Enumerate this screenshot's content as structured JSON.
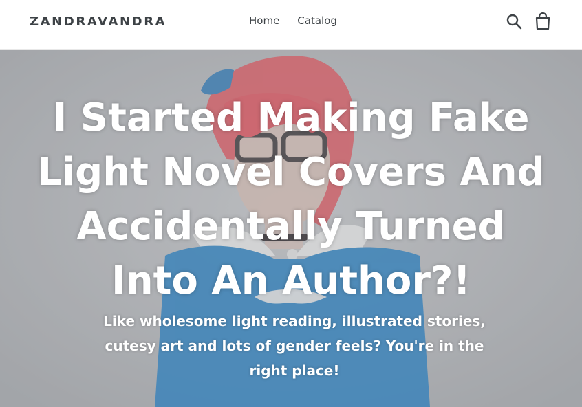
{
  "header": {
    "logo": "ZANDRAVANDRA",
    "nav": [
      {
        "label": "Home",
        "active": true
      },
      {
        "label": "Catalog",
        "active": false
      }
    ],
    "icons": [
      "search-icon",
      "cart-icon"
    ]
  },
  "hero": {
    "title": "I Started Making Fake Light Novel Covers And Accidentally Turned Into An Author?!",
    "subtitle": "Like wholesome light reading, illustrated stories, cutesy art and lots of gender feels? You're in the right place!"
  },
  "colors": {
    "text": "#3d4246",
    "hero_overlay": "#b4b6ba",
    "hair": "#e8434f",
    "dress": "#1f74b5"
  }
}
